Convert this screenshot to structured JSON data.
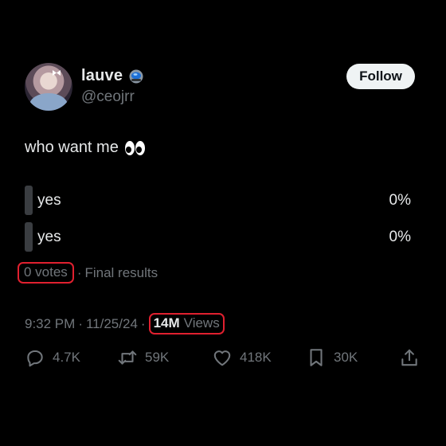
{
  "author": {
    "display_name": "lauve",
    "handle": "@ceojrr",
    "verified_color": "#1d9bf0"
  },
  "follow_label": "Follow",
  "post": {
    "text": "who want me",
    "emoji_icon": "eyes-emoji"
  },
  "poll": {
    "options": [
      {
        "label": "yes",
        "percent": "0%"
      },
      {
        "label": "yes",
        "percent": "0%"
      }
    ],
    "votes": "0 votes",
    "status": "Final results"
  },
  "meta": {
    "time": "9:32 PM",
    "date": "11/25/24",
    "views_count": "14M",
    "views_label": "Views"
  },
  "actions": {
    "replies": "4.7K",
    "reposts": "59K",
    "likes": "418K",
    "bookmarks": "30K"
  },
  "colors": {
    "background": "#000000",
    "text": "#e7e9ea",
    "muted": "#71767b",
    "highlight_box": "#e0202f"
  }
}
